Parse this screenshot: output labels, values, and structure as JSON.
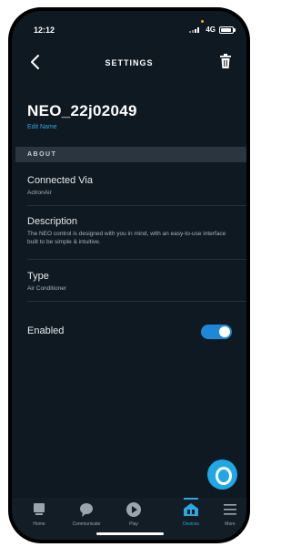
{
  "status_bar": {
    "time": "12:12",
    "network": "4G"
  },
  "header": {
    "title": "SETTINGS"
  },
  "device": {
    "name": "NEO_22j02049",
    "edit_label": "Edit Name"
  },
  "section": {
    "title": "ABOUT"
  },
  "rows": [
    {
      "label": "Connected Via",
      "value": "ActronAir"
    },
    {
      "label": "Description",
      "value": "The NEO control is designed with you in mind, with an easy-to-use interface built to be simple & intuitive."
    },
    {
      "label": "Type",
      "value": "Air Conditioner"
    }
  ],
  "enabled": {
    "label": "Enabled",
    "on": true
  },
  "nav": [
    {
      "label": "Home",
      "icon": "home-icon"
    },
    {
      "label": "Communicate",
      "icon": "chat-bubble-icon"
    },
    {
      "label": "Play",
      "icon": "play-icon"
    },
    {
      "label": "Devices",
      "icon": "devices-house-icon",
      "active": true
    },
    {
      "label": "More",
      "icon": "menu-icon"
    }
  ],
  "colors": {
    "accent": "#2ea7e0",
    "background": "#0f1921",
    "toggle": "#1e88d8"
  }
}
